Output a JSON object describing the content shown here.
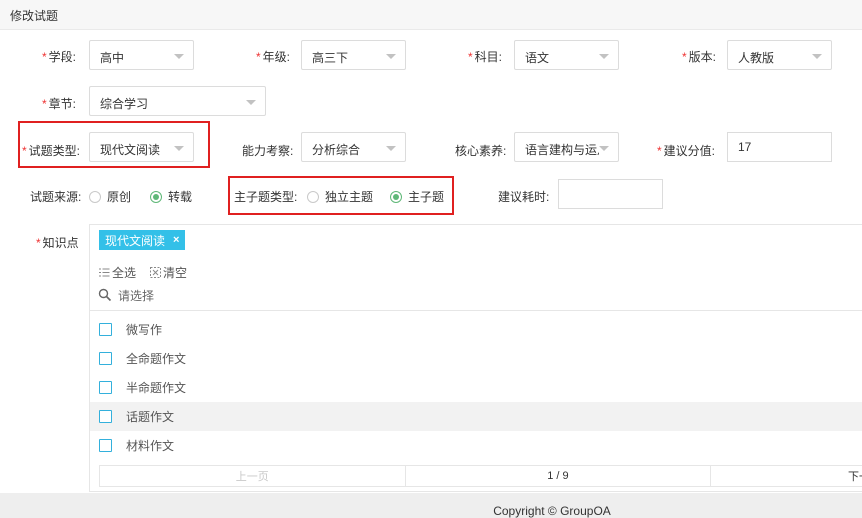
{
  "title": "修改试题",
  "fields": {
    "xueduan": {
      "label": "学段:",
      "value": "高中"
    },
    "nianji": {
      "label": "年级:",
      "value": "高三下"
    },
    "kemu": {
      "label": "科目:",
      "value": "语文"
    },
    "banben": {
      "label": "版本:",
      "value": "人教版"
    },
    "zhangjie": {
      "label": "章节:",
      "value": "综合学习"
    },
    "tixing": {
      "label": "试题类型:",
      "value": "现代文阅读"
    },
    "nengli": {
      "label": "能力考察:",
      "value": "分析综合"
    },
    "suyang": {
      "label": "核心素养:",
      "value": "语言建构与运月"
    },
    "fenzhi": {
      "label": "建议分值:",
      "value": "17"
    }
  },
  "required_mark": "*",
  "source": {
    "label": "试题来源:",
    "options": [
      "原创",
      "转载"
    ],
    "selected": "转载"
  },
  "master_type": {
    "label": "主子题类型:",
    "options": [
      "独立主题",
      "主子题"
    ],
    "selected": "主子题"
  },
  "time": {
    "label": "建议耗时:",
    "value": ""
  },
  "knowledge": {
    "label": "知识点",
    "tags": [
      {
        "text": "现代文阅读",
        "remove": "×"
      }
    ],
    "select_all": "全选",
    "clear": "清空",
    "search_placeholder": "请选择",
    "items": [
      "微写作",
      "全命题作文",
      "半命题作文",
      "话题作文",
      "材料作文"
    ],
    "highlighted_index": 3,
    "pager": {
      "prev": "上一页",
      "info": "1 / 9",
      "next": "下一"
    }
  },
  "footer": "Copyright © GroupOA",
  "colors": {
    "accent": "#5fb878",
    "tag": "#33c0e8",
    "required": "#e33333",
    "highlight_box": "#e02020"
  }
}
